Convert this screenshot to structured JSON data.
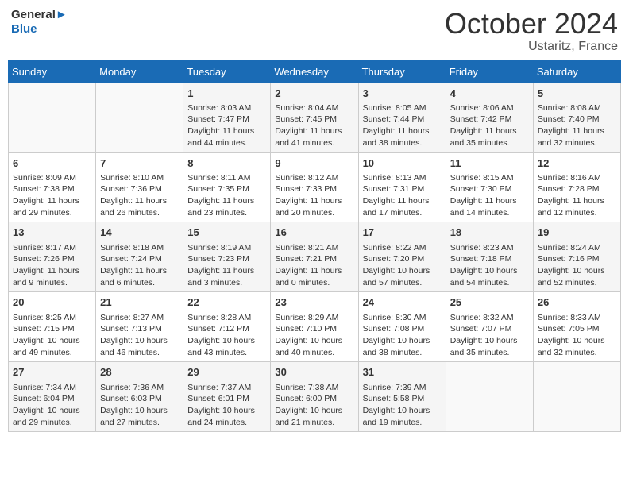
{
  "header": {
    "logo_line1": "General",
    "logo_line2": "Blue",
    "month": "October 2024",
    "location": "Ustaritz, France"
  },
  "weekdays": [
    "Sunday",
    "Monday",
    "Tuesday",
    "Wednesday",
    "Thursday",
    "Friday",
    "Saturday"
  ],
  "weeks": [
    [
      {
        "day": "",
        "info": ""
      },
      {
        "day": "",
        "info": ""
      },
      {
        "day": "1",
        "info": "Sunrise: 8:03 AM\nSunset: 7:47 PM\nDaylight: 11 hours and 44 minutes."
      },
      {
        "day": "2",
        "info": "Sunrise: 8:04 AM\nSunset: 7:45 PM\nDaylight: 11 hours and 41 minutes."
      },
      {
        "day": "3",
        "info": "Sunrise: 8:05 AM\nSunset: 7:44 PM\nDaylight: 11 hours and 38 minutes."
      },
      {
        "day": "4",
        "info": "Sunrise: 8:06 AM\nSunset: 7:42 PM\nDaylight: 11 hours and 35 minutes."
      },
      {
        "day": "5",
        "info": "Sunrise: 8:08 AM\nSunset: 7:40 PM\nDaylight: 11 hours and 32 minutes."
      }
    ],
    [
      {
        "day": "6",
        "info": "Sunrise: 8:09 AM\nSunset: 7:38 PM\nDaylight: 11 hours and 29 minutes."
      },
      {
        "day": "7",
        "info": "Sunrise: 8:10 AM\nSunset: 7:36 PM\nDaylight: 11 hours and 26 minutes."
      },
      {
        "day": "8",
        "info": "Sunrise: 8:11 AM\nSunset: 7:35 PM\nDaylight: 11 hours and 23 minutes."
      },
      {
        "day": "9",
        "info": "Sunrise: 8:12 AM\nSunset: 7:33 PM\nDaylight: 11 hours and 20 minutes."
      },
      {
        "day": "10",
        "info": "Sunrise: 8:13 AM\nSunset: 7:31 PM\nDaylight: 11 hours and 17 minutes."
      },
      {
        "day": "11",
        "info": "Sunrise: 8:15 AM\nSunset: 7:30 PM\nDaylight: 11 hours and 14 minutes."
      },
      {
        "day": "12",
        "info": "Sunrise: 8:16 AM\nSunset: 7:28 PM\nDaylight: 11 hours and 12 minutes."
      }
    ],
    [
      {
        "day": "13",
        "info": "Sunrise: 8:17 AM\nSunset: 7:26 PM\nDaylight: 11 hours and 9 minutes."
      },
      {
        "day": "14",
        "info": "Sunrise: 8:18 AM\nSunset: 7:24 PM\nDaylight: 11 hours and 6 minutes."
      },
      {
        "day": "15",
        "info": "Sunrise: 8:19 AM\nSunset: 7:23 PM\nDaylight: 11 hours and 3 minutes."
      },
      {
        "day": "16",
        "info": "Sunrise: 8:21 AM\nSunset: 7:21 PM\nDaylight: 11 hours and 0 minutes."
      },
      {
        "day": "17",
        "info": "Sunrise: 8:22 AM\nSunset: 7:20 PM\nDaylight: 10 hours and 57 minutes."
      },
      {
        "day": "18",
        "info": "Sunrise: 8:23 AM\nSunset: 7:18 PM\nDaylight: 10 hours and 54 minutes."
      },
      {
        "day": "19",
        "info": "Sunrise: 8:24 AM\nSunset: 7:16 PM\nDaylight: 10 hours and 52 minutes."
      }
    ],
    [
      {
        "day": "20",
        "info": "Sunrise: 8:25 AM\nSunset: 7:15 PM\nDaylight: 10 hours and 49 minutes."
      },
      {
        "day": "21",
        "info": "Sunrise: 8:27 AM\nSunset: 7:13 PM\nDaylight: 10 hours and 46 minutes."
      },
      {
        "day": "22",
        "info": "Sunrise: 8:28 AM\nSunset: 7:12 PM\nDaylight: 10 hours and 43 minutes."
      },
      {
        "day": "23",
        "info": "Sunrise: 8:29 AM\nSunset: 7:10 PM\nDaylight: 10 hours and 40 minutes."
      },
      {
        "day": "24",
        "info": "Sunrise: 8:30 AM\nSunset: 7:08 PM\nDaylight: 10 hours and 38 minutes."
      },
      {
        "day": "25",
        "info": "Sunrise: 8:32 AM\nSunset: 7:07 PM\nDaylight: 10 hours and 35 minutes."
      },
      {
        "day": "26",
        "info": "Sunrise: 8:33 AM\nSunset: 7:05 PM\nDaylight: 10 hours and 32 minutes."
      }
    ],
    [
      {
        "day": "27",
        "info": "Sunrise: 7:34 AM\nSunset: 6:04 PM\nDaylight: 10 hours and 29 minutes."
      },
      {
        "day": "28",
        "info": "Sunrise: 7:36 AM\nSunset: 6:03 PM\nDaylight: 10 hours and 27 minutes."
      },
      {
        "day": "29",
        "info": "Sunrise: 7:37 AM\nSunset: 6:01 PM\nDaylight: 10 hours and 24 minutes."
      },
      {
        "day": "30",
        "info": "Sunrise: 7:38 AM\nSunset: 6:00 PM\nDaylight: 10 hours and 21 minutes."
      },
      {
        "day": "31",
        "info": "Sunrise: 7:39 AM\nSunset: 5:58 PM\nDaylight: 10 hours and 19 minutes."
      },
      {
        "day": "",
        "info": ""
      },
      {
        "day": "",
        "info": ""
      }
    ]
  ]
}
